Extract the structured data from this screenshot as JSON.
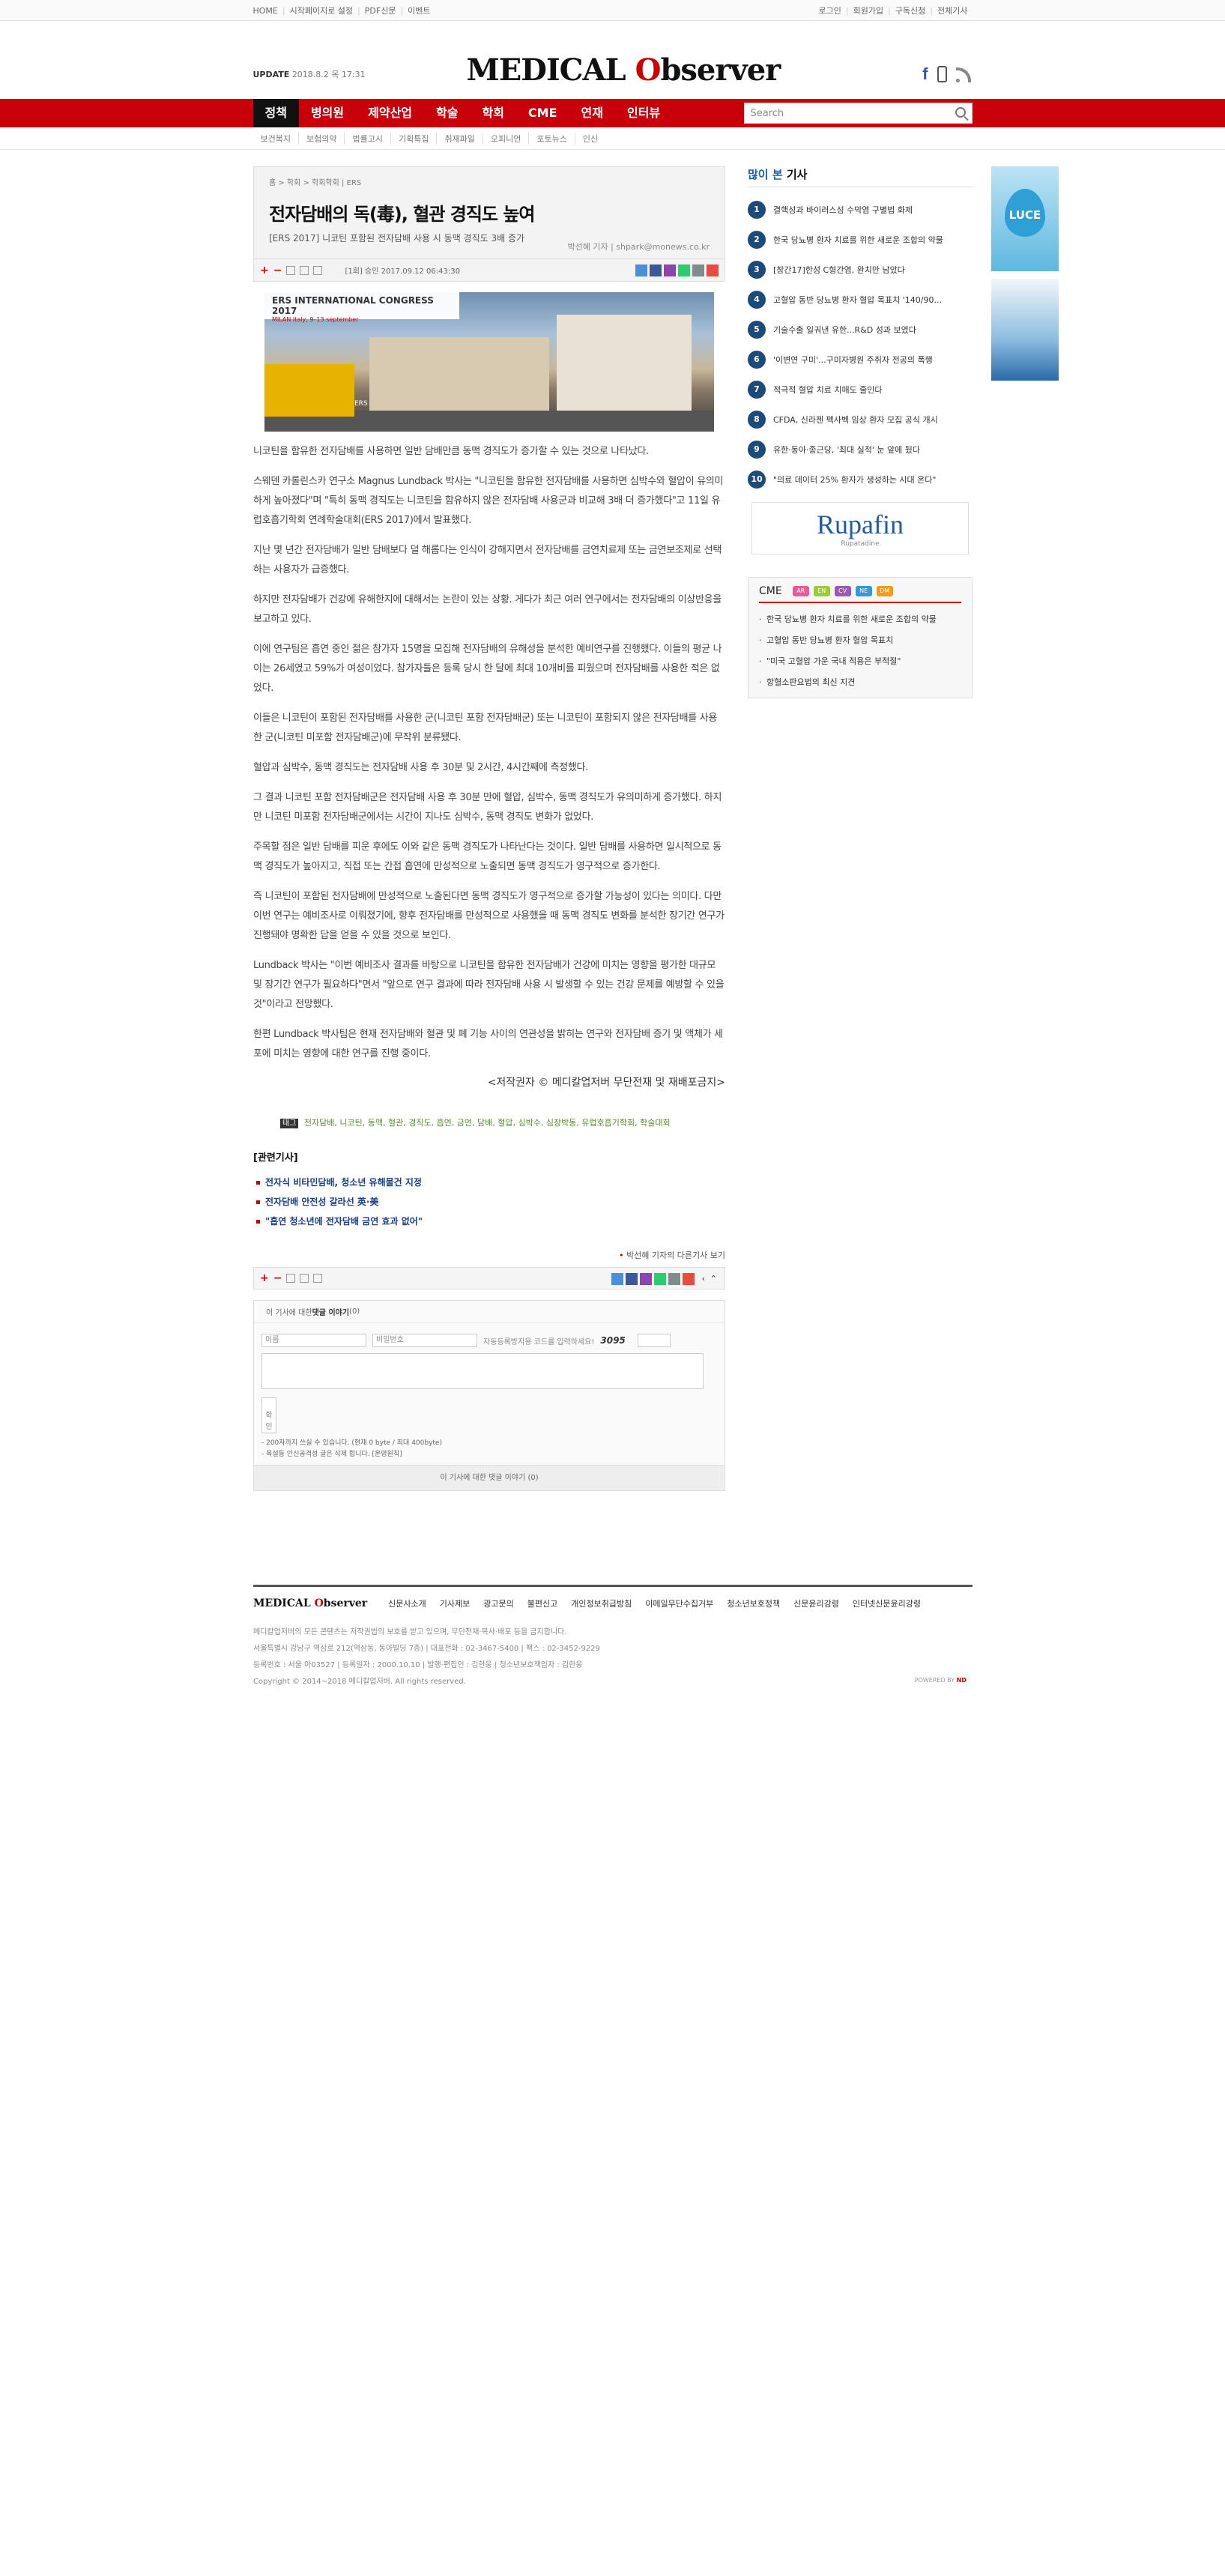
{
  "topbar": {
    "left_links": [
      "HOME",
      "시작페이지로 설정",
      "PDF신문",
      "이벤트"
    ],
    "right_links": [
      "로그인",
      "회원가입",
      "구독신청",
      "전체기사"
    ]
  },
  "header": {
    "update_label": "UPDATE",
    "update_date": "2018.8.2 목 17:31",
    "logo_left": "MEDICAL ",
    "logo_o": "O",
    "logo_right": "bserver"
  },
  "nav": {
    "items": [
      "정책",
      "병의원",
      "제약산업",
      "학술",
      "학회",
      "CME",
      "연재",
      "인터뷰"
    ],
    "search_placeholder": "Search"
  },
  "subnav": [
    "보건복지",
    "보험의약",
    "법률고시",
    "기획특집",
    "취재파일",
    "오피니언",
    "포토뉴스",
    "인신"
  ],
  "article": {
    "breadcrumb": "홈 > 학회 > 학회학회 | ERS",
    "title": "전자담배의 독(毒), 혈관 경직도 높여",
    "subtitle": "[ERS 2017] 니코틴 포함된 전자담배 사용 시 동맥 경직도 3배 증가",
    "byline": "박선혜 기자  |  shpark@monews.co.kr",
    "date": "[1회] 승인 2017.09.12 06:43:30",
    "photo_banner_title": "ERS INTERNATIONAL CONGRESS 2017",
    "photo_banner_sub": "MILAN Italy, 9–13 september",
    "photo_caption": "ERS",
    "paragraphs": [
      "니코틴을 함유한 전자담배를 사용하면 일반 담배만큼 동맥 경직도가 증가할 수 있는 것으로 나타났다.",
      "스웨덴 카롤린스카 연구소 Magnus Lundback 박사는 \"니코틴을 함유한 전자담배를 사용하면 심박수와 혈압이 유의미하게 높아졌다\"며 \"특히 동맥 경직도는 니코틴을 함유하지 않은 전자담배 사용군과 비교해 3배 더 증가했다\"고 11일 유럽호흡기학회 연례학술대회(ERS 2017)에서 발표했다.",
      "지난 몇 년간 전자담배가 일반 담배보다 덜 해롭다는 인식이 강해지면서 전자담배를 금연치료제 또는 금연보조제로 선택하는 사용자가 급증했다.",
      "하지만 전자담배가 건강에 유해한지에 대해서는 논란이 있는 상황. 게다가 최근 여러 연구에서는 전자담배의 이상반응을 보고하고 있다.",
      "이에 연구팀은 흡연 중인 젊은 참가자 15명을 모집해 전자담배의 유해성을 분석한 예비연구를 진행했다. 이들의 평균 나이는 26세였고 59%가 여성이었다. 참가자들은 등록 당시 한 달에 최대 10개비를 피웠으며 전자담배를 사용한 적은 없었다.",
      "이들은 니코틴이 포함된 전자담배를 사용한 군(니코틴 포함 전자담배군) 또는 니코틴이 포함되지 않은 전자담배를 사용한 군(니코틴 미포함 전자담배군)에 무작위 분류됐다.",
      "혈압과 심박수, 동맥 경직도는 전자담배 사용 후 30분 및 2시간, 4시간째에 측정했다.",
      "그 결과 니코틴 포함 전자담배군은 전자담배 사용 후 30분 만에 혈압, 심박수, 동맥 경직도가 유의미하게 증가했다. 하지만 니코틴 미포함 전자담배군에서는 시간이 지나도 심박수, 동맥 경직도 변화가 없었다.",
      "주목할 점은 일반 담배를 피운 후에도 이와 같은 동맥 경직도가 나타난다는 것이다. 일반 담배를 사용하면 일시적으로 동맥 경직도가 높아지고, 직접 또는 간접 흡연에 만성적으로 노출되면 동맥 경직도가 영구적으로 증가한다.",
      "즉 니코틴이 포함된 전자담배에 만성적으로 노출된다면 동맥 경직도가 영구적으로 증가할 가능성이 있다는 의미다. 다만 이번 연구는 예비조사로 이뤄졌기에, 향후 전자담배를 만성적으로 사용했을 때 동맥 경직도 변화를 분석한 장기간 연구가 진행돼야 명확한 답을 얻을 수 있을 것으로 보인다.",
      "Lundback 박사는 \"이번 예비조사 결과를 바탕으로 니코틴을 함유한 전자담배가 건강에 미치는 영향을 평가한 대규모 및 장기간 연구가 필요하다\"면서 \"앞으로 연구 결과에 따라 전자담배 사용 시 발생할 수 있는 건강 문제를 예방할 수 있을 것\"이라고 전망했다.",
      "한편 Lundback 박사팀은 현재 전자담배와 혈관 및 폐 기능 사이의 연관성을 밝히는 연구와 전자담배 증기 및 액체가 세포에 미치는 영향에 대한 연구를 진행 중이다."
    ],
    "copyright": "<저작권자 © 메디칼업저버 무단전재 및 재배포금지>",
    "tag_label": "태그",
    "tags": "전자담배, 니코틴, 동맥, 혈관, 경직도, 흡연, 금연, 담배, 혈압, 심박수, 심장박동, 유럽호흡기학회, 학술대회",
    "related_title": "[관련기사]",
    "related": [
      "전자식 비타민담배, 청소년 유해물건 지정",
      "전자담배 안전성 갈라선 英·美",
      "\"흡연 청소년에 전자담배 금연 효과 없어\""
    ],
    "more_link": "박선혜 기자의 다른기사 보기"
  },
  "comment": {
    "header_pre": "이 기사에 대한 ",
    "header_bold": "댓글 이야기",
    "header_count": " (0)",
    "name_ph": "이름",
    "pw_ph": "비밀번호",
    "captcha_label": "자동등록방지용 코드를 입력하세요!",
    "captcha_code": "3095",
    "submit": "확인",
    "note1": "200자까지 쓰실 수 있습니다. (현재 0 byte / 최대 400byte)",
    "note2": "욕설등 인신공격성 글은 삭제 합니다. [운영원칙]",
    "footer": "이 기사에 대한 댓글 이야기 (0)"
  },
  "sidebar": {
    "popular_title_a": "많이 본",
    "popular_title_b": " 기사",
    "popular": [
      "결핵성과 바이러스성 수막염 구별법 화제",
      "한국 당뇨병 환자 치료를 위한 새로운 조합의 약물",
      "[창간17]한성 C형간염, 완치만 남았다",
      "고혈압 동반 당뇨병 환자 혈압 목표치 '140/90...",
      "기술수출 일궈낸 유한...R&D 성과 보였다",
      "'이변연 구미'...구미자병원 주취자 전공의 폭행",
      "적극적 혈압 치료 치매도 줄인다",
      "CFDA, 신라젠 펙사벡 임상 환자 모집 공식 개시",
      "유한·동아·종근당, '최대 실적' 눈 앞에 뒀다",
      "\"의료 데이터 25% 환자가 생성하는 시대 온다\""
    ],
    "ad_brand": "Rupafin",
    "ad_sub": "Rupatadine",
    "cme_title": "CME",
    "cme_badges": [
      "AR",
      "EN",
      "CV",
      "NE",
      "DM"
    ],
    "cme_colors": [
      "#e85a9a",
      "#9acd32",
      "#9b59b6",
      "#3498db",
      "#f39c12"
    ],
    "cme_items": [
      "한국 당뇨병 환자 치료를 위한 새로운 조합의 약물",
      "고혈압 동반 당뇨병 환자 혈압 목표치",
      "\"미국 고혈압 가운 국내 적용은 부적절\"",
      "항혈소판요법의 최신 지견"
    ]
  },
  "right_ads": {
    "luce": "LUCE"
  },
  "footer": {
    "logo_left": "MEDICAL ",
    "logo_o": "O",
    "logo_right": "bserver",
    "links": [
      "신문사소개",
      "기사제보",
      "광고문의",
      "불편신고",
      "개인정보취급방침",
      "이메일무단수집거부",
      "청소년보호정책",
      "신문윤리강령",
      "인터넷신문윤리강령"
    ],
    "line1": "메디칼업저버의 모든 콘텐츠는 저작권법의 보호를 받고 있으며, 무단전재·복사·배포 등을 금지합니다.",
    "line2": "서울특별시 강남구 역삼로 212(역삼동, 동아빌딩 7층)  |  대표전화 : 02-3467-5400  |  팩스 : 02-3452-9229",
    "line3": "등록번호 : 서울 아03527  |  등록일자 : 2000.10.10  |  발행·편집인 : 김한웅  |  청소년보호책임자 : 김한웅",
    "line4": "Copyright © 2014~2018 메디칼업저버. All rights reserved.",
    "powered": "POWERED BY",
    "powered_brand": "ND"
  }
}
